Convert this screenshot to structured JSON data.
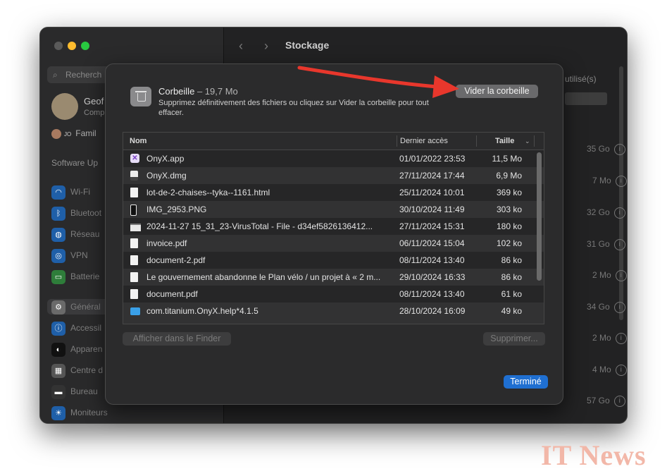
{
  "window": {
    "toolbar_title": "Stockage",
    "search_placeholder": "Recherch",
    "profile": {
      "name": "Geof",
      "subtitle": "Comp"
    },
    "family": {
      "initials": "JO",
      "label": "Famil"
    },
    "section_label": "Software Up",
    "sidebar_items": [
      "Wi-Fi",
      "Bluetoot",
      "Réseau",
      "VPN",
      "Batterie",
      "Général",
      "Accessil",
      "Apparen",
      "Centre d",
      "Bureau",
      "Moniteurs"
    ],
    "used_label": "o utilisé(s)",
    "background_sizes": [
      "35 Go",
      "7 Mo",
      "32 Go",
      "31 Go",
      "2 Mo",
      "34 Go",
      "2 Mo",
      "4 Mo",
      "57 Go"
    ]
  },
  "dialog": {
    "title": "Corbeille",
    "size": "– 19,7 Mo",
    "description": "Supprimez définitivement des fichiers ou cliquez sur Vider la corbeille pour tout effacer.",
    "empty_button": "Vider la corbeille",
    "columns": {
      "name": "Nom",
      "date": "Dernier accès",
      "size": "Taille"
    },
    "files": [
      {
        "name": "OnyX.app",
        "date": "01/01/2022 23:53",
        "size": "11,5 Mo",
        "icon": "app-icon"
      },
      {
        "name": "OnyX.dmg",
        "date": "27/11/2024 17:44",
        "size": "6,9 Mo",
        "icon": "dmg-icon"
      },
      {
        "name": "lot-de-2-chaises--tyka--1161.html",
        "date": "25/11/2024 10:01",
        "size": "369 ko",
        "icon": "document-icon"
      },
      {
        "name": "IMG_2953.PNG",
        "date": "30/10/2024 11:49",
        "size": "303 ko",
        "icon": "image-icon"
      },
      {
        "name": "2024-11-27 15_31_23-VirusTotal - File - d34ef5826136412...",
        "date": "27/11/2024 15:31",
        "size": "180 ko",
        "icon": "screenshot-icon"
      },
      {
        "name": "invoice.pdf",
        "date": "06/11/2024 15:04",
        "size": "102 ko",
        "icon": "document-icon"
      },
      {
        "name": "document-2.pdf",
        "date": "08/11/2024 13:40",
        "size": "86 ko",
        "icon": "document-icon"
      },
      {
        "name": "Le gouvernement abandonne le Plan vélo / un projet à « 2 m...",
        "date": "29/10/2024 16:33",
        "size": "86 ko",
        "icon": "document-icon"
      },
      {
        "name": "document.pdf",
        "date": "08/11/2024 13:40",
        "size": "61 ko",
        "icon": "document-icon"
      },
      {
        "name": "com.titanium.OnyX.help*4.1.5",
        "date": "28/10/2024 16:09",
        "size": "49 ko",
        "icon": "folder-icon"
      }
    ],
    "finder_button": "Afficher dans le Finder",
    "delete_button": "Supprimer...",
    "done_button": "Terminé"
  },
  "watermark": "IT News",
  "colors": {
    "accent": "#1f6fd1",
    "annotation_arrow": "#e8372c"
  }
}
